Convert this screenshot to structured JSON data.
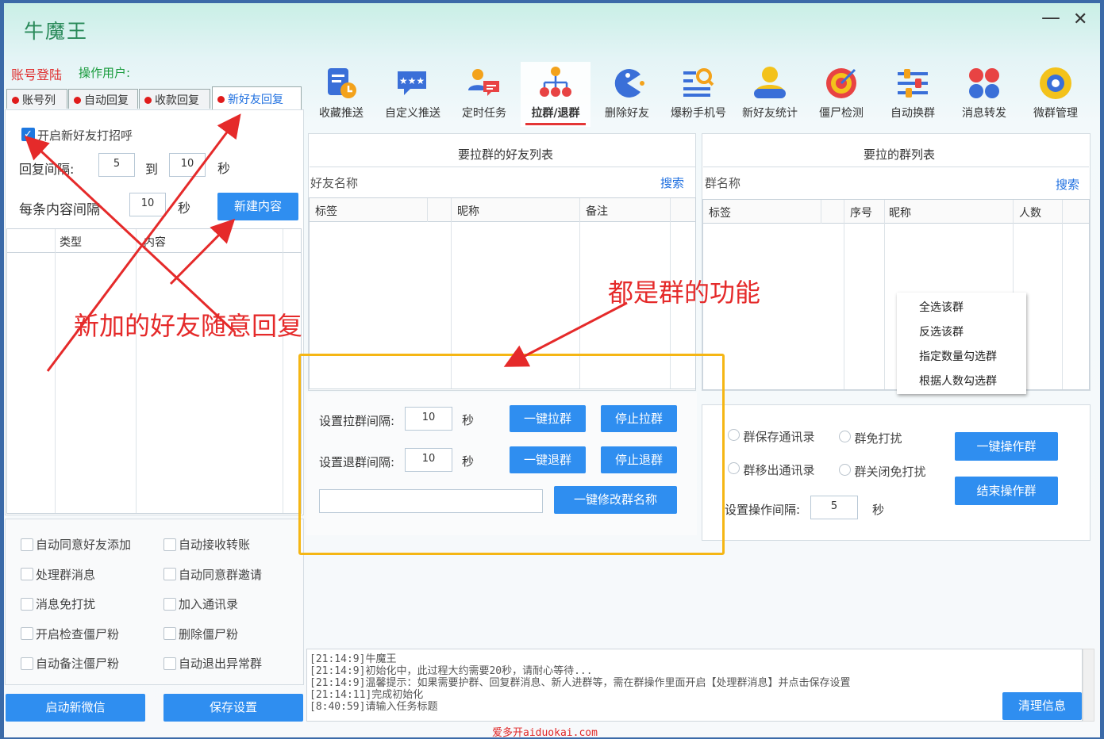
{
  "window": {
    "title": "牛魔王",
    "minimize": "—",
    "close": "✕"
  },
  "header": {
    "account_login": "账号登陆",
    "operator": "操作用户:"
  },
  "toolbar": [
    {
      "label": "收藏推送",
      "icon": "doc-clock-icon"
    },
    {
      "label": "自定义推送",
      "icon": "chat-stars-icon"
    },
    {
      "label": "定时任务",
      "icon": "user-chat-icon"
    },
    {
      "label": "拉群/退群",
      "icon": "org-tree-icon",
      "selected": true
    },
    {
      "label": "删除好友",
      "icon": "pacman-icon"
    },
    {
      "label": "爆粉手机号",
      "icon": "search-list-icon"
    },
    {
      "label": "新好友统计",
      "icon": "user-stats-icon"
    },
    {
      "label": "僵尸检测",
      "icon": "target-icon"
    },
    {
      "label": "自动换群",
      "icon": "sliders-icon"
    },
    {
      "label": "消息转发",
      "icon": "dots-grid-icon"
    },
    {
      "label": "微群管理",
      "icon": "gear-flower-icon"
    }
  ],
  "tabs": [
    {
      "label": "账号列"
    },
    {
      "label": "自动回复"
    },
    {
      "label": "收款回复"
    },
    {
      "label": "新好友回复",
      "selected": true
    }
  ],
  "greeting": {
    "enable_label": "开启新好友打招呼",
    "interval_label": "回复间隔:",
    "interval_from": "5",
    "to_label": "到",
    "interval_to": "10",
    "sec": "秒",
    "item_interval_label": "每条内容间隔",
    "item_interval": "10",
    "new_button": "新建内容",
    "col_type": "类型",
    "col_content": "内容"
  },
  "options": [
    "自动同意好友添加",
    "自动接收转账",
    "处理群消息",
    "自动同意群邀请",
    "消息免打扰",
    "加入通讯录",
    "开启检查僵尸粉",
    "删除僵尸粉",
    "自动备注僵尸粉",
    "自动退出异常群"
  ],
  "bottom_buttons": {
    "start": "启动新微信",
    "save": "保存设置"
  },
  "friends_panel": {
    "title": "要拉群的好友列表",
    "search_label": "好友名称",
    "search_btn": "搜索",
    "cols": [
      "标签",
      "昵称",
      "备注"
    ]
  },
  "groups_panel": {
    "title": "要拉的群列表",
    "search_label": "群名称",
    "search_btn": "搜索",
    "cols": [
      "标签",
      "序号",
      "昵称",
      "人数"
    ]
  },
  "context_menu": [
    "全选该群",
    "反选该群",
    "指定数量勾选群",
    "根据人数勾选群"
  ],
  "pull": {
    "pull_interval_label": "设置拉群间隔:",
    "pull_interval": "10",
    "quit_interval_label": "设置退群间隔:",
    "quit_interval": "10",
    "sec": "秒",
    "pull_btn": "一键拉群",
    "stop_pull_btn": "停止拉群",
    "quit_btn": "一键退群",
    "stop_quit_btn": "停止退群",
    "rename_btn": "一键修改群名称",
    "rename_value": ""
  },
  "group_ops": {
    "radios": [
      "群保存通讯录",
      "群免打扰",
      "群移出通讯录",
      "群关闭免打扰"
    ],
    "op_btn": "一键操作群",
    "end_btn": "结束操作群",
    "interval_label": "设置操作间隔:",
    "interval": "5",
    "sec": "秒"
  },
  "log": {
    "lines": [
      "[21:14:9]牛魔王",
      "[21:14:9]初始化中，此过程大约需要20秒，请耐心等待...",
      "[21:14:9]温馨提示：如果需要护群、回复群消息、新人进群等，需在群操作里面开启【处理群消息】并点击保存设置",
      "[21:14:11]完成初始化",
      "[8:40:59]请输入任务标题"
    ],
    "clear_btn": "清理信息"
  },
  "annotations": {
    "left": "新加的好友随意回复",
    "right": "都是群的功能"
  },
  "watermark": "爱多开aiduokai.com"
}
